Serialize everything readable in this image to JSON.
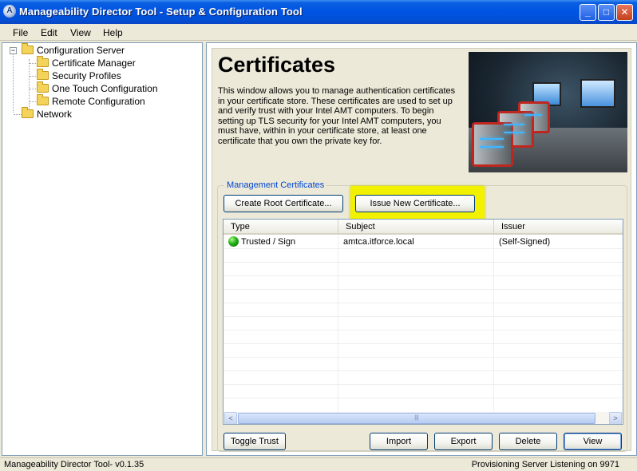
{
  "window": {
    "title": "Manageability Director Tool - Setup & Configuration Tool",
    "app_icon_glyph": "A"
  },
  "window_controls": {
    "minimize": "_",
    "maximize": "□",
    "close": "✕"
  },
  "menu": [
    "File",
    "Edit",
    "View",
    "Help"
  ],
  "tree": {
    "expander": "−",
    "root": "Configuration Server",
    "children": [
      "Certificate Manager",
      "Security Profiles",
      "One Touch Configuration",
      "Remote Configuration"
    ],
    "sibling": "Network"
  },
  "page": {
    "title": "Certificates",
    "description": "This window allows you to manage authentication certificates in your certificate store. These certificates are used to set up and verify trust with your Intel AMT computers. To begin setting up TLS security for your Intel AMT computers, you must have, within in your certificate store, at least one certificate that you own the private key for."
  },
  "certificates": {
    "group_title": "Management Certificates",
    "create_root_label": "Create Root Certificate...",
    "issue_new_label": "Issue New Certificate...",
    "columns": [
      "Type",
      "Subject",
      "Issuer"
    ],
    "rows": [
      {
        "type": "Trusted / Sign",
        "subject": "amtca.itforce.local",
        "issuer": "(Self-Signed)",
        "status_color": "#27b017"
      }
    ],
    "scroll_left": "<",
    "scroll_right": ">",
    "scroll_grip": "|||",
    "buttons": {
      "toggle_trust": "Toggle Trust",
      "import": "Import",
      "export": "Export",
      "delete": "Delete",
      "view": "View"
    }
  },
  "status": {
    "left": "Manageability Director Tool- v0.1.35",
    "right": "Provisioning Server Listening on 9971"
  },
  "colors": {
    "titlebar": "#0054e3",
    "highlight": "#f2f200",
    "group_title": "#0046d5"
  },
  "icons": [
    "app-icon",
    "minimize-icon",
    "maximize-icon",
    "close-icon",
    "folder-icon",
    "status-ok-icon"
  ]
}
